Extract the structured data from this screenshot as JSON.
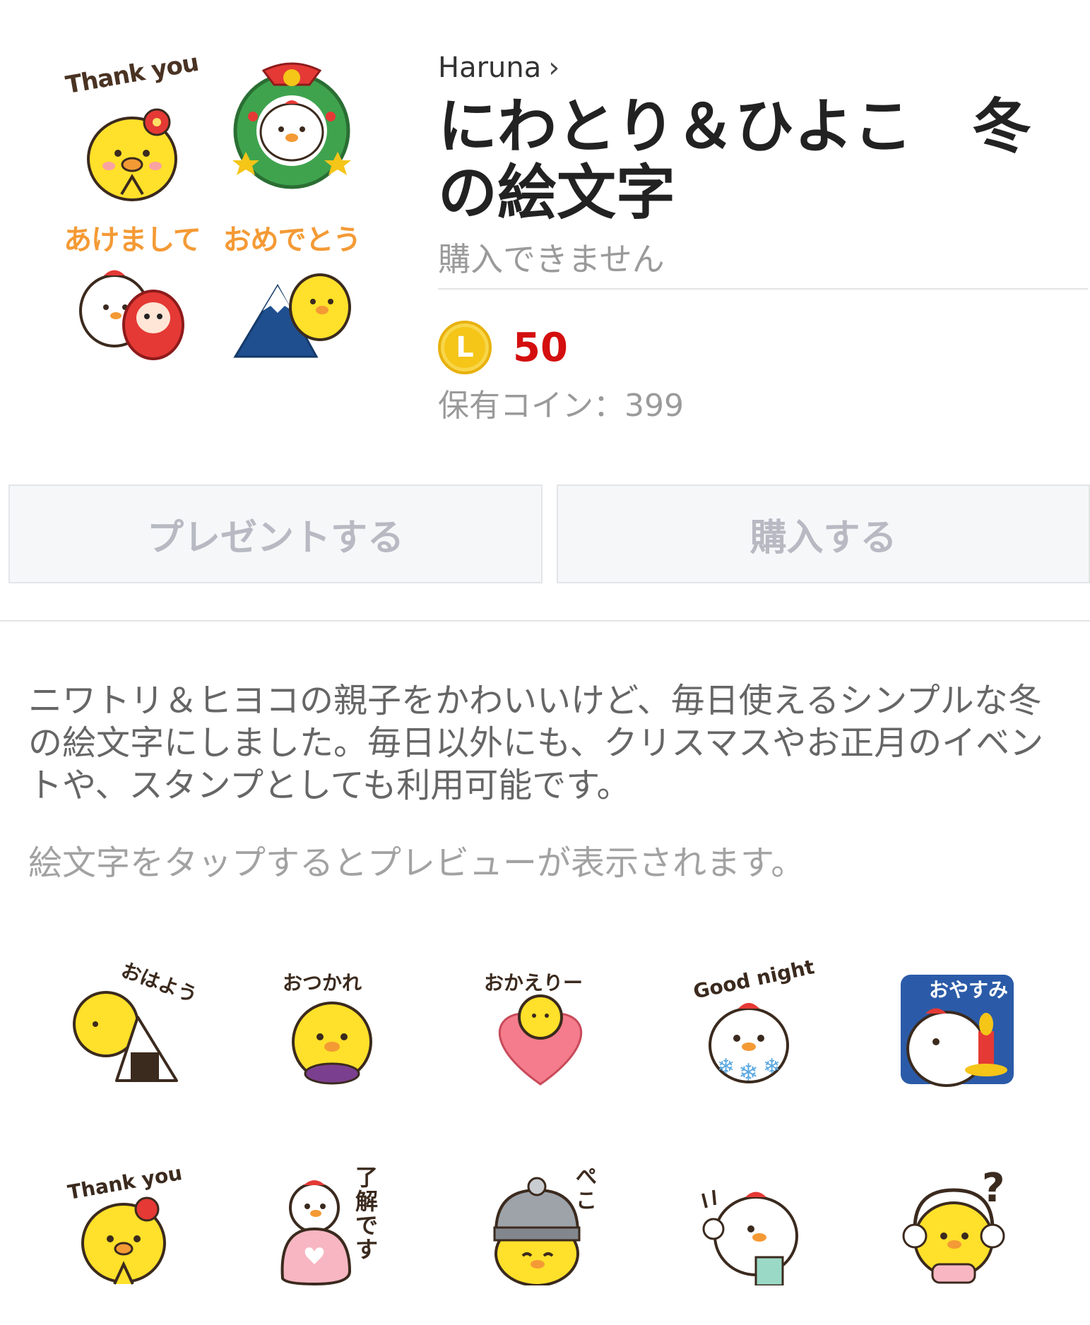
{
  "header": {
    "author": "Haruna",
    "title": "にわとり＆ひよこ　冬の絵文字",
    "status": "購入できません",
    "coin_letter": "L",
    "price": "50",
    "owned_coins": "保有コイン：399"
  },
  "cover": {
    "cells": [
      {
        "caption": "Thank you",
        "icon": "chick-thank-you"
      },
      {
        "caption": "",
        "icon": "wreath-chicken"
      },
      {
        "caption": "あけまして",
        "icon": "chicken-daruma"
      },
      {
        "caption": "おめでとう",
        "icon": "chick-mount-fuji"
      }
    ]
  },
  "buttons": {
    "present": "プレゼントする",
    "buy": "購入する"
  },
  "description": "ニワトリ＆ヒヨコの親子をかわいいけど、毎日使えるシンプルな冬の絵文字にしました。毎日以外にも、クリスマスやお正月のイベントや、スタンプとしても利用可能です。",
  "hint": "絵文字をタップするとプレビューが表示されます。",
  "emoji": [
    {
      "label": "おはよう",
      "icon": "chick-onigiri"
    },
    {
      "label": "おつかれ",
      "icon": "chick-sweet-potato"
    },
    {
      "label": "おかえりー",
      "icon": "chick-heart"
    },
    {
      "label": "Good night",
      "icon": "chicken-snowflake"
    },
    {
      "label": "おやすみ",
      "icon": "chicken-candle"
    },
    {
      "label": "Thank you",
      "icon": "chick-thank-you"
    },
    {
      "label": "了解です",
      "icon": "chicken-mitten"
    },
    {
      "label": "ぺこ",
      "icon": "chick-knit-hat"
    },
    {
      "label": "",
      "icon": "chicken-scarf"
    },
    {
      "label": "?",
      "icon": "chick-earmuffs"
    }
  ],
  "colors": {
    "price": "#d40e0e",
    "coin": "#f5c518",
    "chick": "#ffe02a",
    "comb": "#e53935",
    "caption_orange": "#f49a35"
  }
}
